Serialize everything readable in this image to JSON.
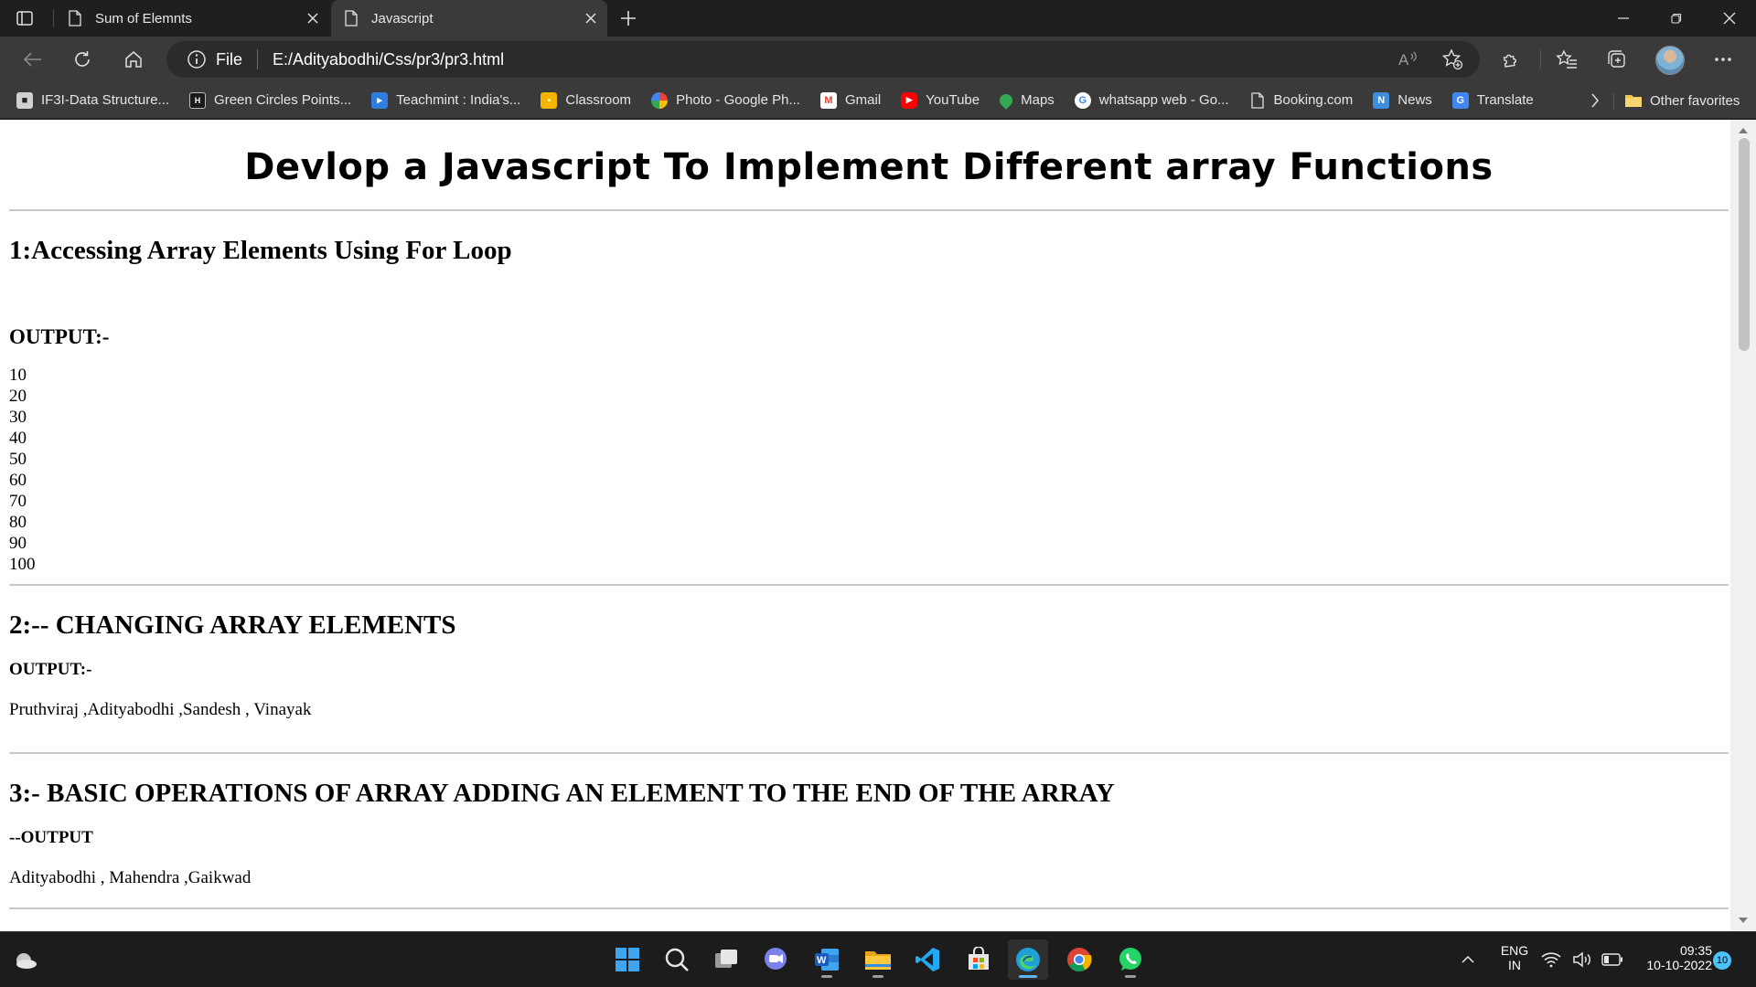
{
  "browser": {
    "tabs": [
      {
        "title": "Sum of Elemnts",
        "active": false
      },
      {
        "title": "Javascript",
        "active": true
      }
    ],
    "address": {
      "scheme_label": "File",
      "url": "E:/Adityabodhi/Css/pr3/pr3.html"
    },
    "favorites": [
      {
        "label": "IF3I-Data Structure...",
        "icon": "classroom-icon",
        "color": "#3c3c3c"
      },
      {
        "label": "Green Circles Points...",
        "icon": "hd-icon",
        "color": "#3c3c3c"
      },
      {
        "label": "Teachmint : India's...",
        "icon": "teachmint-icon",
        "color": "#2f7de1"
      },
      {
        "label": "Classroom",
        "icon": "google-classroom-icon",
        "color": "#f4b400"
      },
      {
        "label": "Photo - Google Ph...",
        "icon": "google-photos-icon",
        "color": "#ea4335"
      },
      {
        "label": "Gmail",
        "icon": "gmail-icon",
        "color": "#ea4335"
      },
      {
        "label": "YouTube",
        "icon": "youtube-icon",
        "color": "#ff0000"
      },
      {
        "label": "Maps",
        "icon": "google-maps-icon",
        "color": "#34a853"
      },
      {
        "label": "whatsapp web - Go...",
        "icon": "google-icon",
        "color": "#4285f4"
      },
      {
        "label": "Booking.com",
        "icon": "page-icon",
        "color": "#3c3c3c"
      },
      {
        "label": "News",
        "icon": "news-icon",
        "color": "#3f8ede"
      },
      {
        "label": "Translate",
        "icon": "translate-icon",
        "color": "#4285f4"
      }
    ],
    "other_favorites": "Other favorites"
  },
  "page": {
    "title": "Devlop a Javascript To Implement Different array Functions",
    "section1": {
      "heading": "1:Accessing Array Elements Using For Loop",
      "output_label": "OUTPUT:-",
      "values": [
        "10",
        "20",
        "30",
        "40",
        "50",
        "60",
        "70",
        "80",
        "90",
        "100"
      ]
    },
    "section2": {
      "heading": "2:-- CHANGING ARRAY ELEMENTS",
      "output_label": "OUTPUT:-",
      "result": "Pruthviraj ,Adityabodhi ,Sandesh , Vinayak"
    },
    "section3": {
      "heading": "3:- BASIC OPERATIONS OF ARRAY ADDING AN ELEMENT TO THE END OF THE ARRAY",
      "output_label": "--OUTPUT",
      "result": "Adityabodhi , Mahendra ,Gaikwad"
    }
  },
  "taskbar": {
    "language": "ENG",
    "region": "IN",
    "time": "09:35",
    "date": "10-10-2022",
    "notifications": "10"
  }
}
